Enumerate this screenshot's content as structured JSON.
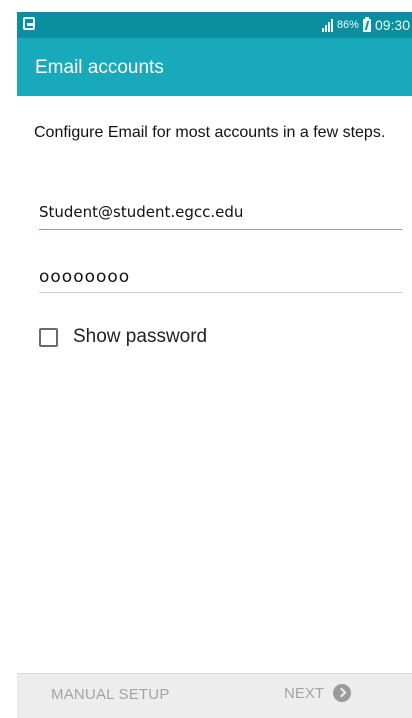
{
  "status_bar": {
    "battery_percent": "86%",
    "time": "09:30",
    "icons": [
      "screenshot-icon",
      "signal-icon",
      "battery-charging-icon"
    ]
  },
  "app_bar": {
    "title": "Email accounts"
  },
  "main": {
    "intro_text": "Configure Email for most accounts in a few steps.",
    "email_value": "Student@student.egcc.edu",
    "password_value": "oooooooo",
    "show_password_label": "Show password",
    "show_password_checked": false
  },
  "bottom_bar": {
    "manual_setup_label": "MANUAL SETUP",
    "next_label": "NEXT"
  },
  "colors": {
    "status_bar": "#0b8fa0",
    "app_bar": "#18a9bb",
    "field_focus_underline": "#5bb4c6",
    "bottom_bar": "#ededed",
    "disabled_text": "#a4a4a4"
  }
}
